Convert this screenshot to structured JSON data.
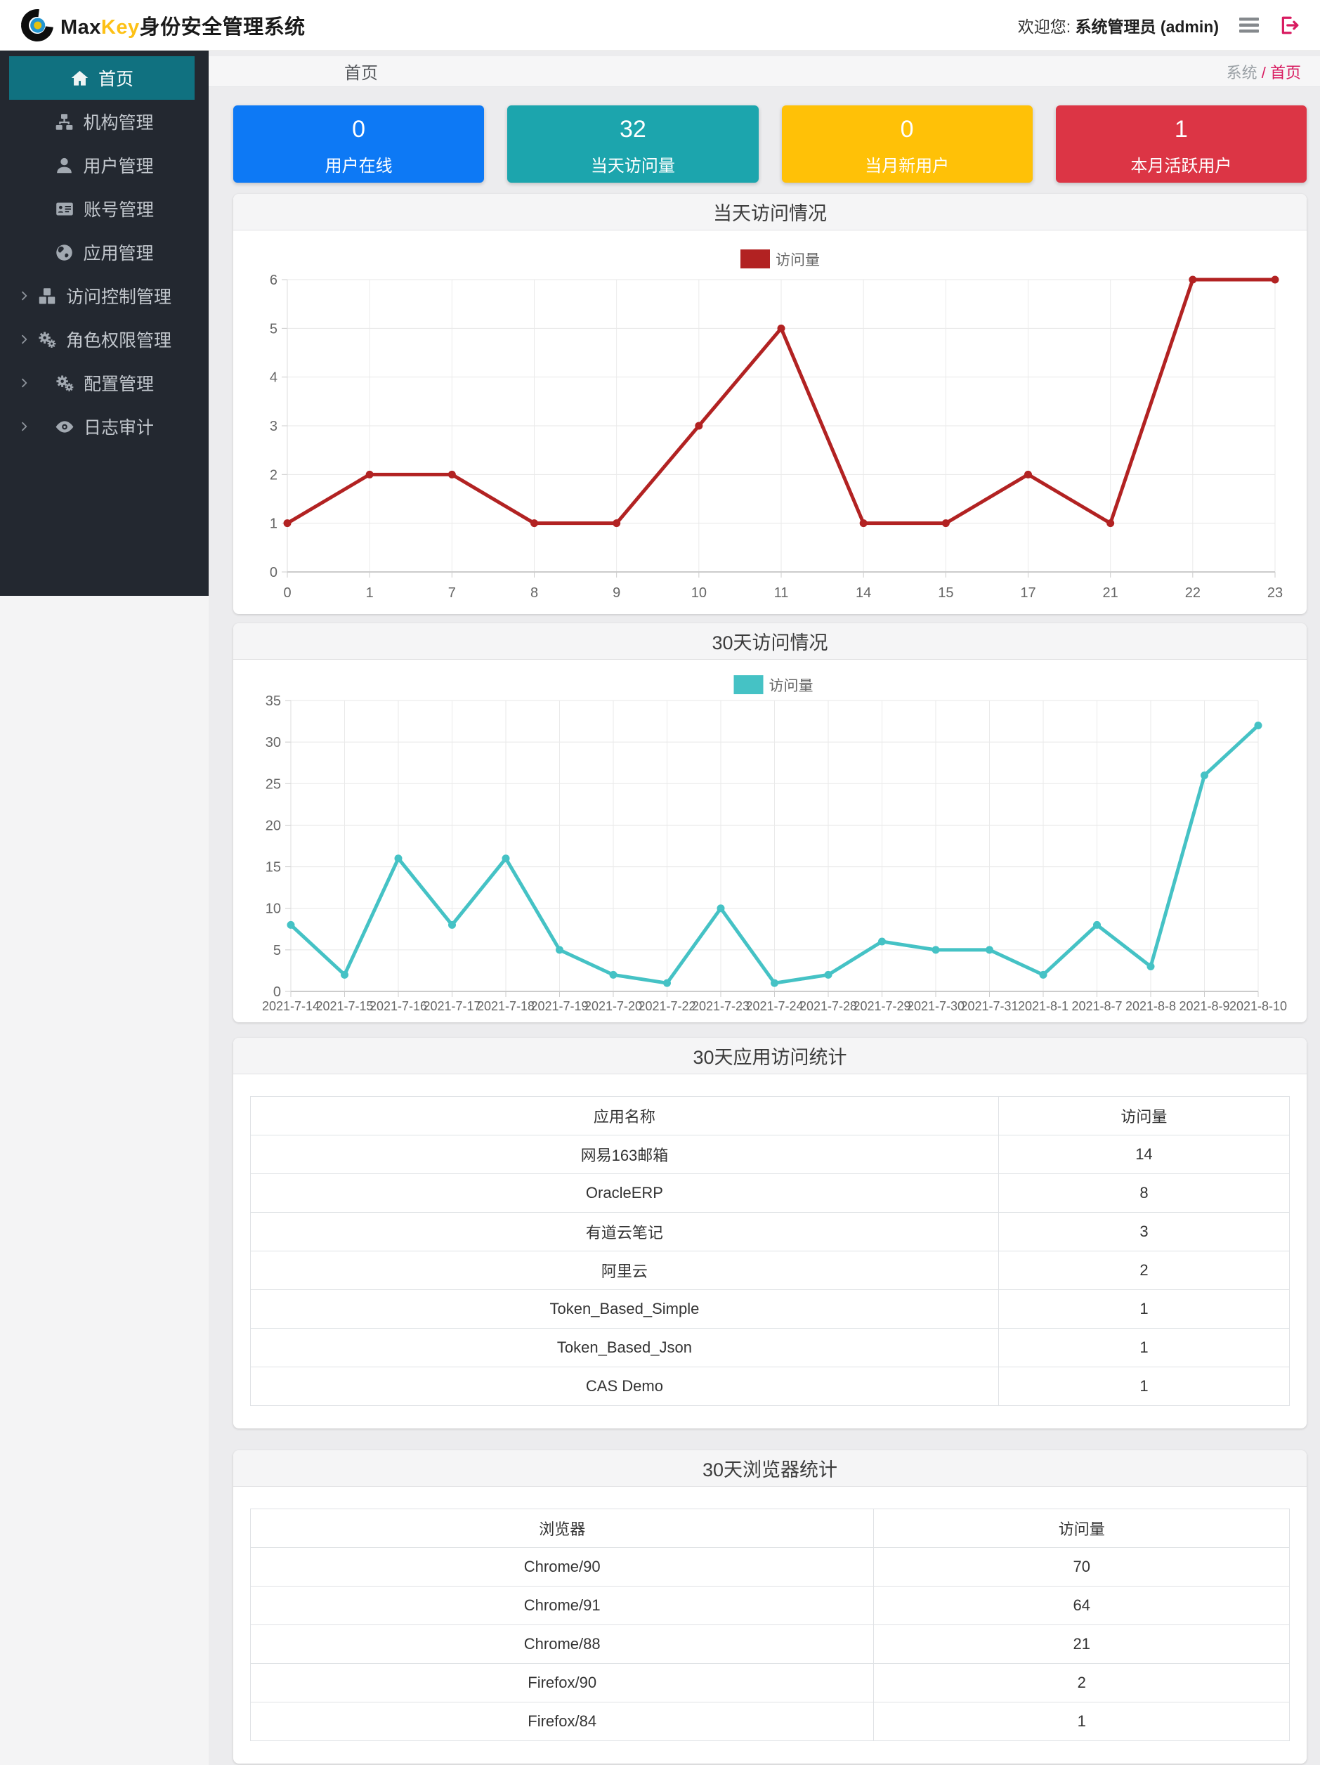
{
  "navbar": {
    "brand_max": "Max",
    "brand_key": "Key",
    "brand_suffix": "身份安全管理系统",
    "welcome_prefix": "欢迎您:",
    "welcome_user": "系统管理员 (admin)"
  },
  "sidebar": {
    "items": [
      {
        "name": "home",
        "label": "首页",
        "icon": "home-icon",
        "active": true,
        "expandable": false
      },
      {
        "name": "org",
        "label": "机构管理",
        "icon": "sitemap-icon",
        "active": false,
        "expandable": false
      },
      {
        "name": "users",
        "label": "用户管理",
        "icon": "user-icon",
        "active": false,
        "expandable": false
      },
      {
        "name": "accounts",
        "label": "账号管理",
        "icon": "id-card-icon",
        "active": false,
        "expandable": false
      },
      {
        "name": "apps",
        "label": "应用管理",
        "icon": "globe-icon",
        "active": false,
        "expandable": false
      },
      {
        "name": "access-control",
        "label": "访问控制管理",
        "icon": "cubes-icon",
        "active": false,
        "expandable": true
      },
      {
        "name": "roles",
        "label": "角色权限管理",
        "icon": "cogs-icon",
        "active": false,
        "expandable": true
      },
      {
        "name": "config",
        "label": "配置管理",
        "icon": "cogs-icon",
        "active": false,
        "expandable": true
      },
      {
        "name": "audit",
        "label": "日志审计",
        "icon": "eye-icon",
        "active": false,
        "expandable": true
      }
    ]
  },
  "breadcrumb": {
    "page_title": "首页",
    "trail_root": "系统",
    "trail_sep": "/",
    "trail_current": "首页"
  },
  "stats": {
    "cards": [
      {
        "value": "0",
        "label": "用户在线",
        "color": "#0d79f5"
      },
      {
        "value": "32",
        "label": "当天访问量",
        "color": "#1ca5ad"
      },
      {
        "value": "0",
        "label": "当月新用户",
        "color": "#ffc107"
      },
      {
        "value": "1",
        "label": "本月活跃用户",
        "color": "#dc3545"
      }
    ]
  },
  "chart_data": [
    {
      "type": "line",
      "title": "当天访问情况",
      "legend": "访问量",
      "color": "#b22222",
      "categories": [
        "0",
        "1",
        "7",
        "8",
        "9",
        "10",
        "11",
        "14",
        "15",
        "17",
        "21",
        "22",
        "23"
      ],
      "values": [
        1,
        2,
        2,
        1,
        1,
        3,
        5,
        1,
        1,
        2,
        1,
        6,
        6
      ],
      "xlabel": "",
      "ylabel": "",
      "ylim": [
        0,
        6
      ],
      "ytick_step": 1,
      "grid": true,
      "legend_position": "top-center"
    },
    {
      "type": "line",
      "title": "30天访问情况",
      "legend": "访问量",
      "color": "#45c2c5",
      "categories": [
        "2021-7-14",
        "2021-7-15",
        "2021-7-16",
        "2021-7-17",
        "2021-7-18",
        "2021-7-19",
        "2021-7-20",
        "2021-7-22",
        "2021-7-23",
        "2021-7-24",
        "2021-7-28",
        "2021-7-29",
        "2021-7-30",
        "2021-7-31",
        "2021-8-1",
        "2021-8-7",
        "2021-8-8",
        "2021-8-9",
        "2021-8-10"
      ],
      "values": [
        8,
        2,
        16,
        8,
        16,
        5,
        2,
        1,
        10,
        1,
        2,
        6,
        5,
        5,
        2,
        8,
        3,
        26,
        32
      ],
      "xlabel": "",
      "ylabel": "",
      "ylim": [
        0,
        35
      ],
      "ytick_step": 5,
      "grid": true,
      "legend_position": "top-center"
    }
  ],
  "tables": [
    {
      "title": "30天应用访问统计",
      "columns": [
        "应用名称",
        "访问量"
      ],
      "col_widths": [
        "72%",
        "28%"
      ],
      "rows": [
        [
          "网易163邮箱",
          "14"
        ],
        [
          "OracleERP",
          "8"
        ],
        [
          "有道云笔记",
          "3"
        ],
        [
          "阿里云",
          "2"
        ],
        [
          "Token_Based_Simple",
          "1"
        ],
        [
          "Token_Based_Json",
          "1"
        ],
        [
          "CAS Demo",
          "1"
        ]
      ]
    },
    {
      "title": "30天浏览器统计",
      "columns": [
        "浏览器",
        "访问量"
      ],
      "col_widths": [
        "60%",
        "40%"
      ],
      "rows": [
        [
          "Chrome/90",
          "70"
        ],
        [
          "Chrome/91",
          "64"
        ],
        [
          "Chrome/88",
          "21"
        ],
        [
          "Firefox/90",
          "2"
        ],
        [
          "Firefox/84",
          "1"
        ]
      ]
    }
  ],
  "colors": {
    "accent_teal": "#107180",
    "sidebar_bg": "#232830",
    "breadcrumb_link": "#d81b60",
    "chart1_line": "#b22222",
    "chart2_line": "#45c2c5"
  }
}
